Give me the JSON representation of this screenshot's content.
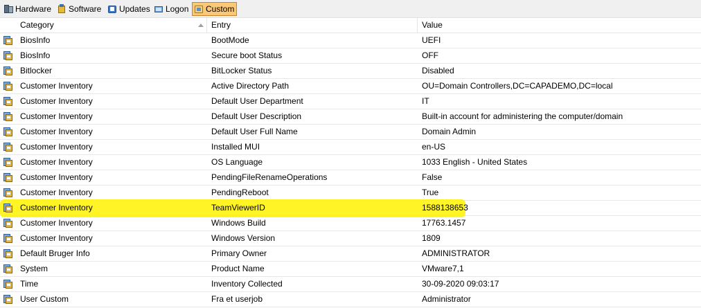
{
  "toolbar": {
    "tabs": [
      {
        "label": "Hardware",
        "icon": "hardware-icon"
      },
      {
        "label": "Software",
        "icon": "software-icon"
      },
      {
        "label": "Updates",
        "icon": "updates-icon"
      },
      {
        "label": "Logon",
        "icon": "logon-icon"
      },
      {
        "label": "Custom",
        "icon": "custom-icon",
        "active": true
      }
    ]
  },
  "table": {
    "columns": [
      "Category",
      "Entry",
      "Value"
    ],
    "sorted_column": "Category",
    "highlight_color": "#fff200",
    "rows": [
      {
        "category": "BiosInfo",
        "entry": "BootMode",
        "value": "UEFI"
      },
      {
        "category": "BiosInfo",
        "entry": "Secure boot Status",
        "value": "OFF"
      },
      {
        "category": "Bitlocker",
        "entry": "BitLocker Status",
        "value": "Disabled"
      },
      {
        "category": "Customer Inventory",
        "entry": "Active Directory Path",
        "value": "OU=Domain Controllers,DC=CAPADEMO,DC=local"
      },
      {
        "category": "Customer Inventory",
        "entry": "Default User Department",
        "value": "IT"
      },
      {
        "category": "Customer Inventory",
        "entry": "Default User Description",
        "value": "Built-in account for administering the computer/domain"
      },
      {
        "category": "Customer Inventory",
        "entry": "Default User Full Name",
        "value": "Domain Admin"
      },
      {
        "category": "Customer Inventory",
        "entry": "Installed MUI",
        "value": "en-US"
      },
      {
        "category": "Customer Inventory",
        "entry": "OS Language",
        "value": "1033 English - United States"
      },
      {
        "category": "Customer Inventory",
        "entry": "PendingFileRenameOperations",
        "value": "False"
      },
      {
        "category": "Customer Inventory",
        "entry": "PendingReboot",
        "value": "True"
      },
      {
        "category": "Customer Inventory",
        "entry": "TeamViewerID",
        "value": "1588138653",
        "highlighted": true
      },
      {
        "category": "Customer Inventory",
        "entry": "Windows Build",
        "value": "17763.1457"
      },
      {
        "category": "Customer Inventory",
        "entry": "Windows Version",
        "value": "1809"
      },
      {
        "category": "Default Bruger Info",
        "entry": "Primary Owner",
        "value": "ADMINISTRATOR"
      },
      {
        "category": "System",
        "entry": "Product Name",
        "value": "VMware7,1"
      },
      {
        "category": "Time",
        "entry": "Inventory Collected",
        "value": "30-09-2020 09:03:17"
      },
      {
        "category": "User Custom",
        "entry": "Fra et userjob",
        "value": "Administrator"
      }
    ]
  }
}
